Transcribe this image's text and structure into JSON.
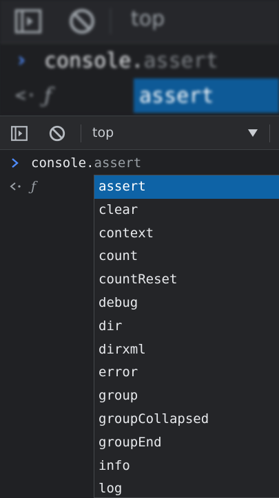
{
  "zoomed_backdrop": {
    "context_label": "top",
    "prompt_symbol": "›",
    "input_object": "console.",
    "input_ghost": "assert",
    "result_arrow": "<·",
    "result_value": "ƒ",
    "selected_suggestion": "assert"
  },
  "toolbar": {
    "sidebar_toggle_icon": "sidebar-toggle-icon",
    "clear_icon": "clear-console-icon",
    "context_label": "top",
    "dropdown_icon": "triangle-down-icon"
  },
  "console": {
    "prompt_symbol": "›",
    "input_object": "console.",
    "input_ghost": "assert",
    "result_arrow": "<·",
    "result_value": "ƒ"
  },
  "autocomplete": {
    "selected_index": 0,
    "items": [
      "assert",
      "clear",
      "context",
      "count",
      "countReset",
      "debug",
      "dir",
      "dirxml",
      "error",
      "group",
      "groupCollapsed",
      "groupEnd",
      "info",
      "log"
    ]
  },
  "colors": {
    "background": "#202124",
    "toolbar": "#292a2d",
    "selection": "#0e63a6",
    "prompt_blue": "#4f8cff"
  }
}
